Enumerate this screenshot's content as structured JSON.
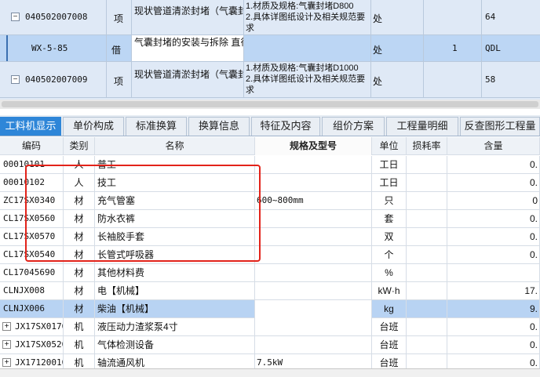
{
  "top_rows": [
    {
      "expand": "−",
      "code": "040502007008",
      "type": "项",
      "name": "现状管道清淤封堵（气囊封堵）",
      "spec": "1.材质及规格:气囊封堵D800\n2.具体详图纸设计及相关规范要求",
      "unit": "处",
      "qty": "",
      "extra": "64"
    },
    {
      "code": "WX-5-85",
      "type": "借",
      "name": "气囊封堵的安装与拆除 直径800mm以内",
      "spec": "",
      "unit": "处",
      "qty": "1",
      "extra": "QDL"
    },
    {
      "expand": "−",
      "code": "040502007009",
      "type": "项",
      "name": "现状管道清淤封堵（气囊封堵）",
      "spec": "1.材质及规格:气囊封堵D1000\n2.具体详图纸设计及相关规范要求",
      "unit": "处",
      "qty": "",
      "extra": "58"
    }
  ],
  "tabs": [
    {
      "label": "工料机显示",
      "active": true
    },
    {
      "label": "单价构成"
    },
    {
      "label": "标准换算"
    },
    {
      "label": "换算信息"
    },
    {
      "label": "特征及内容"
    },
    {
      "label": "组价方案"
    },
    {
      "label": "工程量明细"
    },
    {
      "label": "反查图形工程量"
    }
  ],
  "columns": {
    "code": "编码",
    "type": "类别",
    "name": "名称",
    "spec": "规格及型号",
    "unit": "单位",
    "loss": "损耗率",
    "qty": "含量"
  },
  "rows": [
    {
      "code": "00010101",
      "type": "人",
      "name": "普工",
      "spec": "",
      "unit": "工日",
      "loss": "",
      "qty": "0."
    },
    {
      "code": "00010102",
      "type": "人",
      "name": "技工",
      "spec": "",
      "unit": "工日",
      "loss": "",
      "qty": "0."
    },
    {
      "code": "ZC17SX0340",
      "type": "材",
      "name": "充气管塞",
      "spec": "600~800mm",
      "unit": "只",
      "loss": "",
      "qty": "0"
    },
    {
      "code": "CL17SX0560",
      "type": "材",
      "name": "防水衣裤",
      "spec": "",
      "unit": "套",
      "loss": "",
      "qty": "0."
    },
    {
      "code": "CL17SX0570",
      "type": "材",
      "name": "长袖胶手套",
      "spec": "",
      "unit": "双",
      "loss": "",
      "qty": "0."
    },
    {
      "code": "CL17SX0540",
      "type": "材",
      "name": "长管式呼吸器",
      "spec": "",
      "unit": "个",
      "loss": "",
      "qty": "0."
    },
    {
      "code": "CL17045690",
      "type": "材",
      "name": "其他材料费",
      "spec": "",
      "unit": "%",
      "loss": "",
      "qty": ""
    },
    {
      "code": "CLNJX008",
      "type": "材",
      "name": "电【机械】",
      "spec": "",
      "unit": "kW·h",
      "loss": "",
      "qty": "17."
    },
    {
      "code": "CLNJX006",
      "type": "材",
      "name": "柴油【机械】",
      "spec": "",
      "unit": "kg",
      "loss": "",
      "qty": "9.",
      "selected": true
    },
    {
      "code": "JX17SX0170",
      "type": "机",
      "name": "液压动力渣浆泵4寸",
      "spec": "",
      "unit": "台班",
      "loss": "",
      "qty": "0.",
      "expand": "+"
    },
    {
      "code": "JX17SX0520",
      "type": "机",
      "name": "气体检测设备",
      "spec": "",
      "unit": "台班",
      "loss": "",
      "qty": "0.",
      "expand": "+"
    },
    {
      "code": "JX17120010",
      "type": "机",
      "name": "轴流通风机",
      "spec": "7.5kW",
      "unit": "台班",
      "loss": "",
      "qty": "0.",
      "expand": "+"
    }
  ],
  "colors": {
    "tab_active": "#2e86d8",
    "selected_row": "#b8d3f3",
    "highlight_box": "#e2231a"
  }
}
